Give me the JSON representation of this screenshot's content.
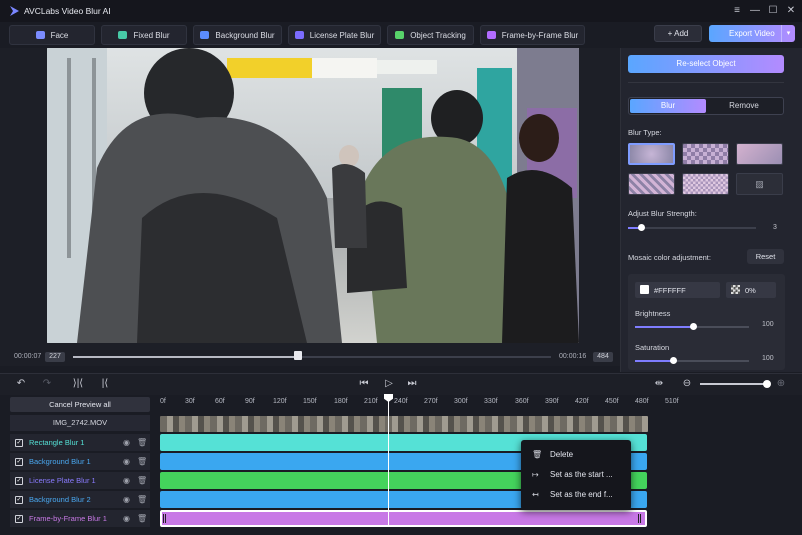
{
  "app": {
    "title": "AVCLabs Video Blur AI"
  },
  "window_controls": {
    "menu": "≡",
    "minimize": "—",
    "maximize": "☐",
    "close": "✕"
  },
  "modes": [
    {
      "label": "Face",
      "icon": "face-icon",
      "color": "#7b8cff"
    },
    {
      "label": "Fixed Blur",
      "icon": "fixed-blur-icon",
      "color": "#47c9a6"
    },
    {
      "label": "Background Blur",
      "icon": "background-blur-icon",
      "color": "#5b8cff"
    },
    {
      "label": "License Plate Blur",
      "icon": "license-plate-icon",
      "color": "#7b6cff"
    },
    {
      "label": "Object Tracking",
      "icon": "object-tracking-icon",
      "color": "#58d36a"
    },
    {
      "label": "Frame-by-Frame Blur",
      "icon": "frame-icon",
      "color": "#b26cff"
    }
  ],
  "header_actions": {
    "add_label": "+ Add",
    "export_label": "Export Video"
  },
  "player": {
    "time_current": "00:00:07",
    "frame_current": "227",
    "time_total": "00:00:16",
    "frame_total": "484",
    "progress": 0.47
  },
  "panel": {
    "reselect_label": "Re-select Object",
    "tab_blur": "Blur",
    "tab_remove": "Remove",
    "blur_type_label": "Blur Type:",
    "strength_label": "Adjust Blur Strength:",
    "strength_value": "3",
    "mosaic_label": "Mosaic color adjustment:",
    "reset_label": "Reset",
    "color_hex": "#FFFFFF",
    "opacity": "0%",
    "brightness_label": "Brightness",
    "brightness_value": "100",
    "saturation_label": "Saturation",
    "saturation_value": "100"
  },
  "timeline": {
    "cancel_preview": "Cancel Preview all",
    "media_name": "IMG_2742.MOV",
    "ticks": [
      "0f",
      "30f",
      "60f",
      "90f",
      "120f",
      "150f",
      "180f",
      "210f",
      "240f",
      "270f",
      "300f",
      "330f",
      "360f",
      "390f",
      "420f",
      "450f",
      "480f",
      "510f"
    ],
    "tracks": [
      {
        "name": "Rectangle Blur 1",
        "color": "#55e1d6",
        "name_color": "#55e1d6"
      },
      {
        "name": "Background Blur 1",
        "color": "#3aa7f0",
        "name_color": "#4aa8f0"
      },
      {
        "name": "License Plate Blur 1",
        "color": "#44d35c",
        "name_color": "#8a7bff"
      },
      {
        "name": "Background Blur 2",
        "color": "#3aa7f0",
        "name_color": "#4aa8f0"
      },
      {
        "name": "Frame-by-Frame Blur 1",
        "color": "#c879e6",
        "name_color": "#c879e6"
      }
    ]
  },
  "context_menu": {
    "items": [
      {
        "label": "Delete",
        "icon": "trash-icon"
      },
      {
        "label": "Set as the start ...",
        "icon": "set-start-icon"
      },
      {
        "label": "Set as the end f...",
        "icon": "set-end-icon"
      }
    ]
  }
}
